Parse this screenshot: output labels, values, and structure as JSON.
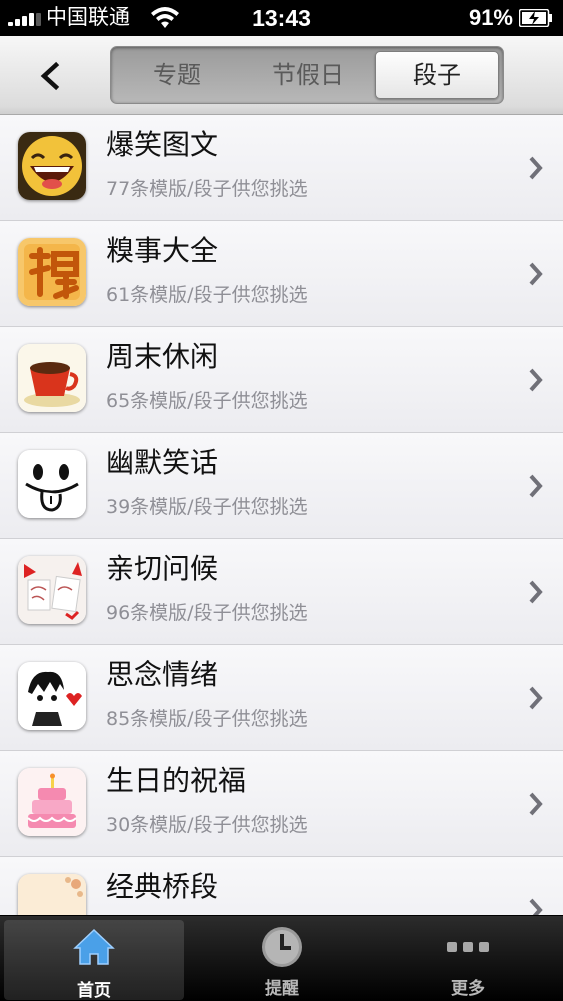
{
  "status_bar": {
    "carrier": "中国联通",
    "time": "13:43",
    "battery": "91%",
    "icons": [
      "signal-icon",
      "wifi-icon",
      "battery-charging-icon"
    ]
  },
  "nav": {
    "back_icon": "back-chevron-icon",
    "segments": [
      "专题",
      "节假日",
      "段子"
    ],
    "selected_segment": "段子"
  },
  "list": {
    "items": [
      {
        "title": "爆笑图文",
        "subtitle": "77条模版/段子供您挑选",
        "icon": "laughing-face-icon"
      },
      {
        "title": "糗事大全",
        "subtitle": "61条模版/段子供您挑选",
        "icon": "qiu-character-icon"
      },
      {
        "title": "周末休闲",
        "subtitle": "65条模版/段子供您挑选",
        "icon": "coffee-cup-icon"
      },
      {
        "title": "幽默笑话",
        "subtitle": "39条模版/段子供您挑选",
        "icon": "tongue-face-icon"
      },
      {
        "title": "亲切问候",
        "subtitle": "96条模版/段子供您挑选",
        "icon": "greeting-card-icon"
      },
      {
        "title": "思念情绪",
        "subtitle": "85条模版/段子供您挑选",
        "icon": "sketch-figure-icon"
      },
      {
        "title": "生日的祝福",
        "subtitle": "30条模版/段子供您挑选",
        "icon": "birthday-cake-icon"
      },
      {
        "title": "经典桥段",
        "subtitle": "",
        "icon": "floral-paper-icon"
      }
    ],
    "chevron_icon": "chevron-right-icon"
  },
  "tabbar": {
    "tabs": [
      {
        "label": "首页",
        "icon": "home-icon",
        "selected": true
      },
      {
        "label": "提醒",
        "icon": "clock-icon",
        "selected": false
      },
      {
        "label": "更多",
        "icon": "more-dots-icon",
        "selected": false
      }
    ]
  },
  "colors": {
    "tab_home_blue": "#4aa0e8",
    "subtitle_gray": "#8f8f96"
  }
}
